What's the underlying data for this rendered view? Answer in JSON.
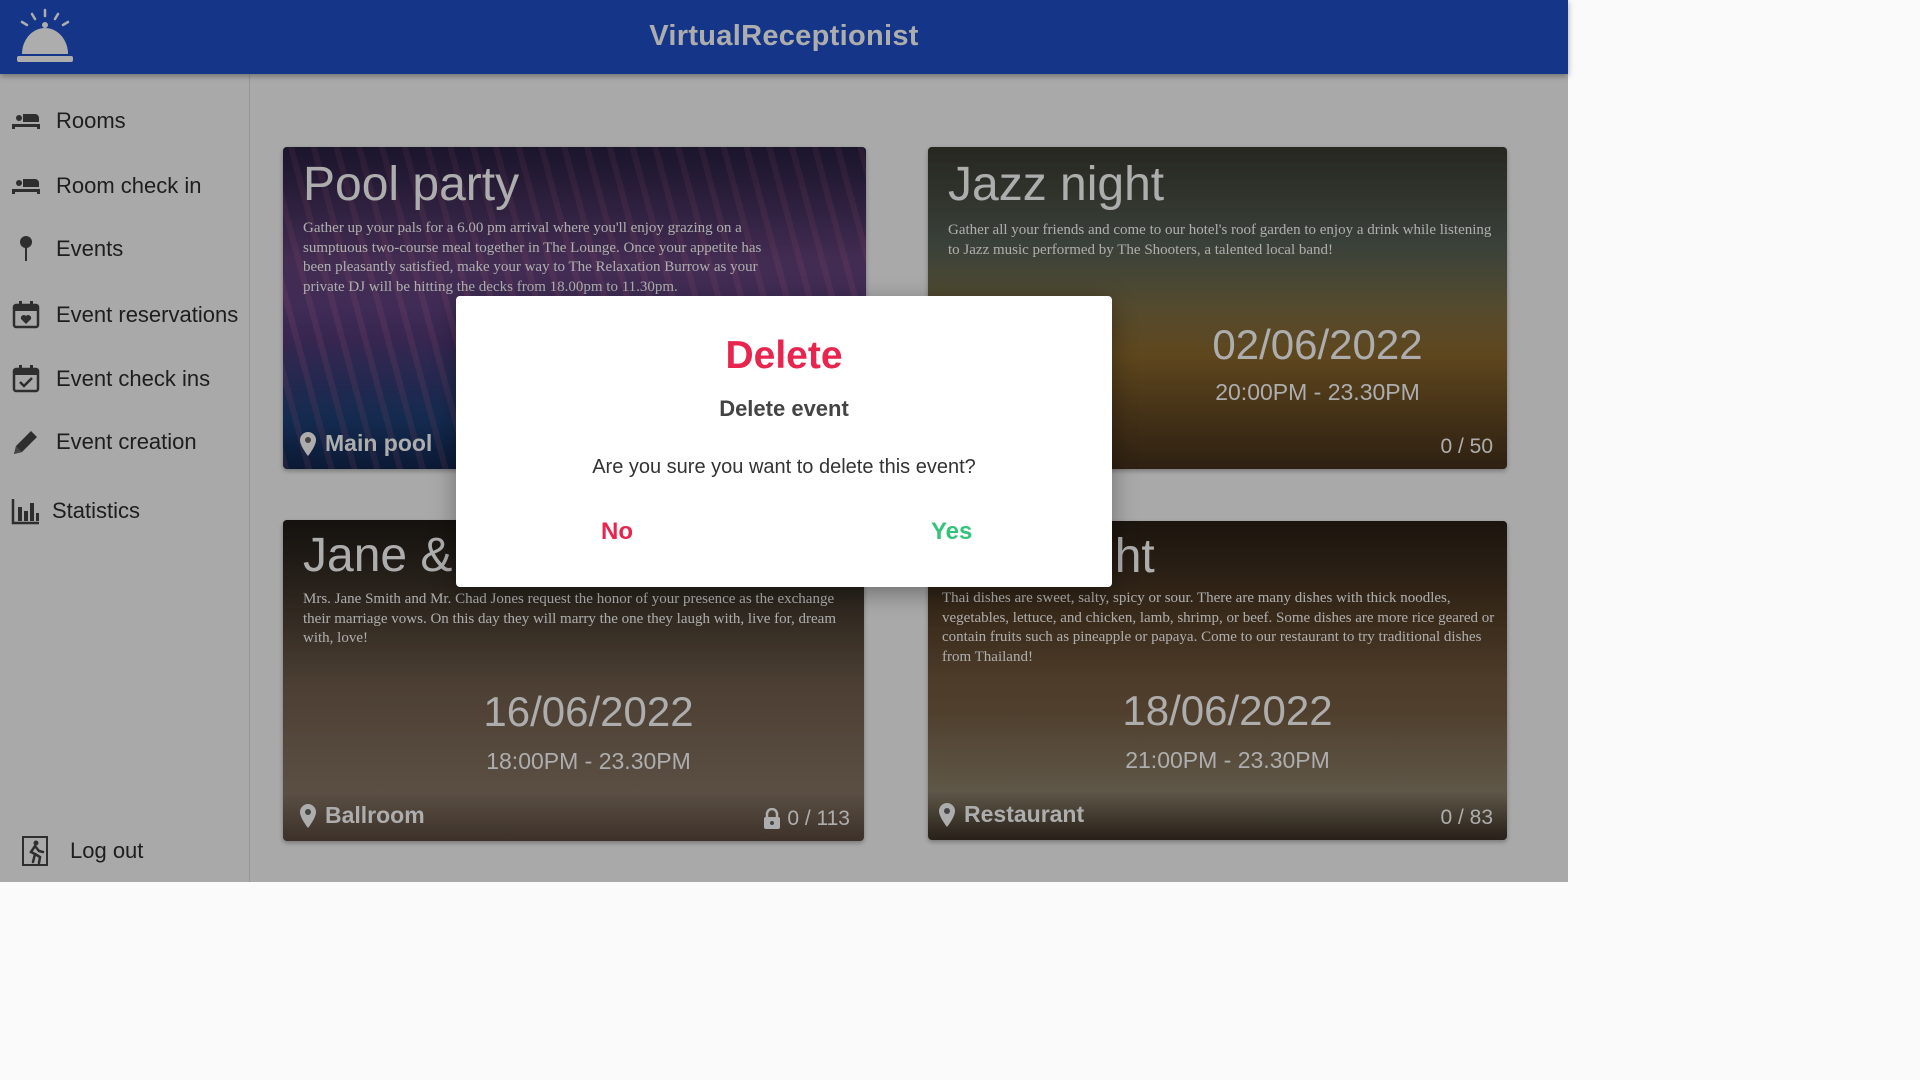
{
  "app": {
    "title": "VirtualReceptionist",
    "logo_icon": "reception-bell-icon"
  },
  "sidebar": {
    "items": [
      {
        "label": "Rooms",
        "icon": "bed-icon"
      },
      {
        "label": "Room check in",
        "icon": "bed-check-icon"
      },
      {
        "label": "Events",
        "icon": "pin-icon"
      },
      {
        "label": "Event reservations",
        "icon": "calendar-heart-icon"
      },
      {
        "label": "Event check ins",
        "icon": "calendar-check-icon"
      },
      {
        "label": "Event creation",
        "icon": "pencil-icon"
      },
      {
        "label": "Statistics",
        "icon": "bar-chart-icon"
      }
    ],
    "logout": {
      "label": "Log out",
      "icon": "exit-icon"
    }
  },
  "events": [
    {
      "title": "Pool party",
      "description": "Gather up your pals for a 6.00 pm arrival where you'll enjoy grazing on a sumptuous two-course meal together in The Lounge. Once your appetite has been pleasantly satisfied, make your way to The Relaxation Burrow as your private DJ will be hitting the decks from 18.00pm to 11.30pm.",
      "location": "Main pool"
    },
    {
      "title": "Jazz night",
      "description": "Gather all your friends and come to our hotel's roof garden to enjoy a drink while listening to Jazz music performed by The Shooters, a talented local band!",
      "date": "02/06/2022",
      "time": "20:00PM - 23.30PM",
      "capacity": "0 / 50"
    },
    {
      "title": "Jane &",
      "description": "Mrs. Jane Smith and Mr. Chad Jones request the honor of your presence as the exchange their marriage vows. On this day they will marry the one they laugh with, live for, dream with, love!",
      "date": "16/06/2022",
      "time": "18:00PM - 23.30PM",
      "location": "Ballroom",
      "capacity": "0 / 113"
    },
    {
      "title": "ght",
      "description": "Thai dishes are sweet, salty, spicy or sour. There are many dishes with thick noodles, vegetables, lettuce, and chicken, lamb, shrimp, or beef. Some dishes are more rice geared or contain fruits such as pineapple or papaya. Come to our restaurant to try traditional dishes from Thailand!",
      "date": "18/06/2022",
      "time": "21:00PM - 23.30PM",
      "location": "Restaurant",
      "capacity": "0 / 83"
    }
  ],
  "dialog": {
    "title": "Delete",
    "subtitle": "Delete event",
    "message": "Are you sure you want to delete this event?",
    "no_label": "No",
    "yes_label": "Yes"
  },
  "colors": {
    "header": "#1e4fc9",
    "danger": "#e8254e",
    "success": "#33c47a"
  }
}
